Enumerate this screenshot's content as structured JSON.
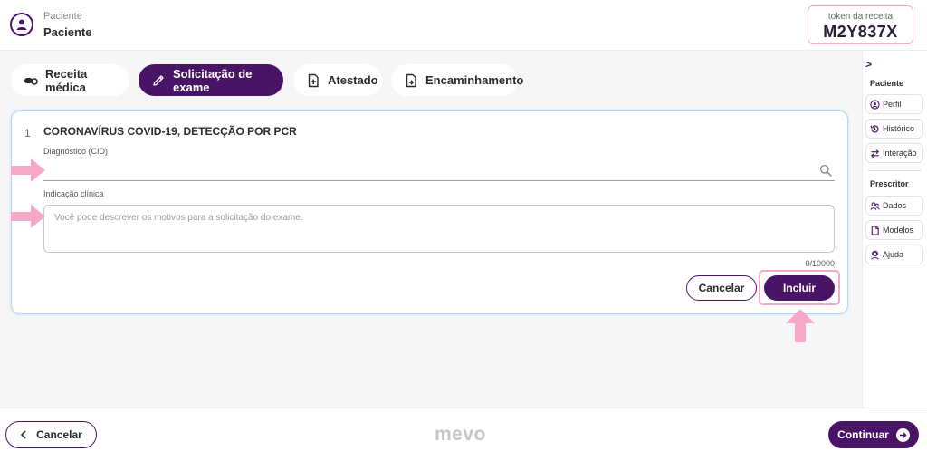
{
  "header": {
    "patient_caption": "Paciente",
    "patient_name": "Paciente",
    "token_caption": "token da receita",
    "token_value": "M2Y837X"
  },
  "tabs": [
    {
      "label": "Receita médica",
      "icon": "pill-icon",
      "active": false
    },
    {
      "label": "Solicitação de exame",
      "icon": "pencil-icon",
      "active": true
    },
    {
      "label": "Atestado",
      "icon": "document-plus-icon",
      "active": false
    },
    {
      "label": "Encaminhamento",
      "icon": "document-arrow-icon",
      "active": false
    }
  ],
  "exam": {
    "number": "1",
    "title": "CORONAVÍRUS COVID-19, DETECÇÃO POR PCR",
    "diagnosis_label": "Diagnóstico (CID)",
    "diagnosis_value": "",
    "indication_label": "Indicação clínica",
    "indication_placeholder": "Você pode descrever os motivos para a solicitação do exame.",
    "indication_value": "",
    "char_count": "0/10000",
    "cancel_label": "Cancelar",
    "include_label": "Incluir"
  },
  "sidebar": {
    "patient_section": "Paciente",
    "patient_items": [
      {
        "label": "Perfil",
        "icon": "user-circle-icon"
      },
      {
        "label": "Histórico",
        "icon": "history-icon"
      },
      {
        "label": "Interação",
        "icon": "swap-arrows-icon"
      }
    ],
    "prescriber_section": "Prescritor",
    "prescriber_items": [
      {
        "label": "Dados",
        "icon": "users-icon"
      },
      {
        "label": "Modelos",
        "icon": "file-icon"
      },
      {
        "label": "Ajuda",
        "icon": "support-agent-icon"
      }
    ]
  },
  "footer": {
    "cancel_label": "Cancelar",
    "logo": "mevo",
    "continue_label": "Continuar"
  },
  "colors": {
    "brand": "#4a1466",
    "highlight": "#f3a9c7",
    "card_border": "#b9d4f1",
    "logo": "#c4c4c9"
  }
}
